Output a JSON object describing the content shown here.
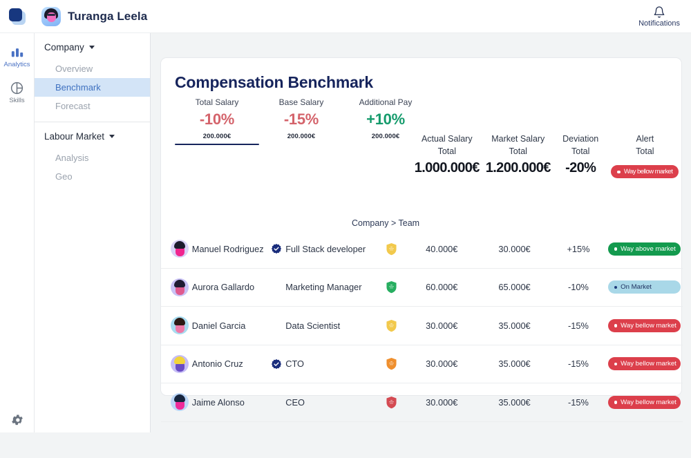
{
  "topbar": {
    "logo_icon": "app-logo-square",
    "user_name": "Turanga Leela",
    "notifications_label": "Notifications",
    "notifications_icon": "bell-icon"
  },
  "rail": {
    "items": [
      {
        "label": "Analytics",
        "icon": "bar-chart-icon",
        "active": true
      },
      {
        "label": "Skills",
        "icon": "pie-chart-icon",
        "active": false
      }
    ],
    "settings_icon": "gear-icon"
  },
  "sidenav": {
    "groups": [
      {
        "title": "Company",
        "caret_icon": "chevron-down-icon",
        "items": [
          {
            "label": "Overview",
            "active": false
          },
          {
            "label": "Benchmark",
            "active": true
          },
          {
            "label": "Forecast",
            "active": false
          }
        ]
      },
      {
        "title": "Labour Market",
        "caret_icon": "chevron-down-icon",
        "items": [
          {
            "label": "Analysis",
            "active": false
          },
          {
            "label": "Geo",
            "active": false
          }
        ]
      }
    ]
  },
  "card": {
    "title": "Compensation Benchmark",
    "breadcrumb": "Company  >  Team",
    "kpis": [
      {
        "label": "Total Salary",
        "value": "-10%",
        "sub": "200.000€",
        "color": "#d4636b",
        "active": true
      },
      {
        "label": "Base Salary",
        "value": "-15%",
        "sub": "200.000€",
        "color": "#d4636b",
        "active": false
      },
      {
        "label": "Additional Pay",
        "value": "+10%",
        "sub": "200.000€",
        "color": "#159b6c",
        "active": false
      }
    ],
    "totals": {
      "columns": [
        {
          "head1": "Actual Salary",
          "head2": "Total",
          "value": "1.000.000€"
        },
        {
          "head1": "Market Salary",
          "head2": "Total",
          "value": "1.200.000€"
        },
        {
          "head1": "Deviation",
          "head2": "Total",
          "value": "-20%"
        },
        {
          "head1": "Alert",
          "head2": "Total",
          "value": "Way bellow market",
          "badge": "below"
        }
      ]
    },
    "rows": [
      {
        "name": "Manuel Rodriguez",
        "verified": true,
        "role": "Full Stack developer",
        "shield_color": "#f2c94c",
        "shield_name": "shield-icon-yellow",
        "actual": "40.000€",
        "market": "30.000€",
        "deviation": "+15%",
        "alert": "Way above market",
        "alert_type": "above",
        "avatar": {
          "bg": "#d9d2f7",
          "hair": "#1c1b2e",
          "face": "#f0258f"
        }
      },
      {
        "name": "Aurora Gallardo",
        "verified": false,
        "role": "Marketing Manager",
        "shield_color": "#27ae60",
        "shield_name": "shield-icon-green",
        "actual": "60.000€",
        "market": "65.000€",
        "deviation": "-10%",
        "alert": "On Market",
        "alert_type": "onmarket",
        "avatar": {
          "bg": "#c9c2f5",
          "hair": "#201c33",
          "face": "#e05a8f"
        }
      },
      {
        "name": "Daniel Garcia",
        "verified": false,
        "role": "Data Scientist",
        "shield_color": "#f2c94c",
        "shield_name": "shield-icon-yellow",
        "actual": "30.000€",
        "market": "35.000€",
        "deviation": "-15%",
        "alert": "Way bellow market",
        "alert_type": "below",
        "avatar": {
          "bg": "#a8dcf0",
          "hair": "#2b1a14",
          "face": "#ee7aa8"
        }
      },
      {
        "name": "Antonio Cruz",
        "verified": true,
        "role": "CTO",
        "shield_color": "#ef8f2e",
        "shield_name": "shield-icon-orange",
        "actual": "30.000€",
        "market": "35.000€",
        "deviation": "-15%",
        "alert": "Way bellow market",
        "alert_type": "below",
        "avatar": {
          "bg": "#c6bdf6",
          "hair": "#f2d43a",
          "face": "#6a4cc4"
        }
      },
      {
        "name": "Jaime Alonso",
        "verified": false,
        "role": "CEO",
        "shield_color": "#d44a52",
        "shield_name": "shield-icon-red",
        "actual": "30.000€",
        "market": "35.000€",
        "deviation": "-15%",
        "alert": "Way bellow market",
        "alert_type": "below",
        "avatar": {
          "bg": "#bcd6f7",
          "hair": "#17263f",
          "face": "#ef2b9a"
        }
      }
    ]
  }
}
